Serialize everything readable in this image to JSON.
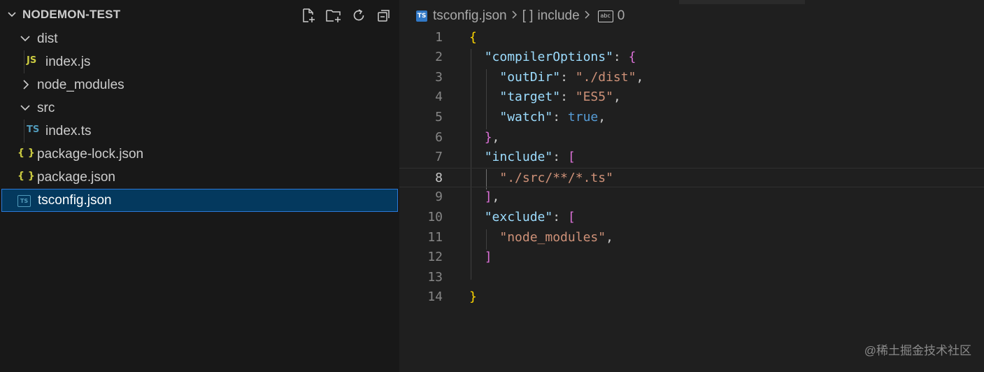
{
  "explorer": {
    "title": "NODEMON-TEST",
    "actions": [
      {
        "name": "new-file-icon"
      },
      {
        "name": "new-folder-icon"
      },
      {
        "name": "refresh-icon"
      },
      {
        "name": "collapse-all-icon"
      }
    ],
    "items": [
      {
        "label": "dist",
        "kind": "folder",
        "expanded": true,
        "depth": 0
      },
      {
        "label": "index.js",
        "kind": "file",
        "icon_text": "JS",
        "icon_color": "#cbcb41",
        "depth": 1
      },
      {
        "label": "node_modules",
        "kind": "folder",
        "expanded": false,
        "depth": 0
      },
      {
        "label": "src",
        "kind": "folder",
        "expanded": true,
        "depth": 0
      },
      {
        "label": "index.ts",
        "kind": "file",
        "icon_text": "TS",
        "icon_color": "#519aba",
        "depth": 1
      },
      {
        "label": "package-lock.json",
        "kind": "file",
        "icon_text": "{ }",
        "icon_color": "#cbcb41",
        "depth": 0
      },
      {
        "label": "package.json",
        "kind": "file",
        "icon_text": "{ }",
        "icon_color": "#cbcb41",
        "depth": 0
      },
      {
        "label": "tsconfig.json",
        "kind": "file",
        "icon_text": "TS",
        "icon_color": "#519aba",
        "depth": 0,
        "selected": true
      }
    ]
  },
  "breadcrumb": {
    "file": "tsconfig.json",
    "file_icon": "TS",
    "symbol": "include",
    "symbol_icon": "[ ]",
    "item_icon": "abc",
    "item": "0"
  },
  "editor": {
    "current_line": 8,
    "lines": [
      {
        "n": "1",
        "tokens": [
          [
            "p1",
            "{"
          ]
        ]
      },
      {
        "n": "2",
        "tokens": [
          [
            "pu",
            "  "
          ],
          [
            "k",
            "\"compilerOptions\""
          ],
          [
            "pu",
            ": "
          ],
          [
            "p2",
            "{"
          ]
        ]
      },
      {
        "n": "3",
        "tokens": [
          [
            "pu",
            "    "
          ],
          [
            "k",
            "\"outDir\""
          ],
          [
            "pu",
            ": "
          ],
          [
            "s",
            "\"./dist\""
          ],
          [
            "pu",
            ","
          ]
        ]
      },
      {
        "n": "4",
        "tokens": [
          [
            "pu",
            "    "
          ],
          [
            "k",
            "\"target\""
          ],
          [
            "pu",
            ": "
          ],
          [
            "s",
            "\"ES5\""
          ],
          [
            "pu",
            ","
          ]
        ]
      },
      {
        "n": "5",
        "tokens": [
          [
            "pu",
            "    "
          ],
          [
            "k",
            "\"watch\""
          ],
          [
            "pu",
            ": "
          ],
          [
            "b",
            "true"
          ],
          [
            "pu",
            ","
          ]
        ]
      },
      {
        "n": "6",
        "tokens": [
          [
            "pu",
            "  "
          ],
          [
            "p2",
            "}"
          ],
          [
            "pu",
            ","
          ]
        ]
      },
      {
        "n": "7",
        "tokens": [
          [
            "pu",
            "  "
          ],
          [
            "k",
            "\"include\""
          ],
          [
            "pu",
            ": "
          ],
          [
            "p2",
            "["
          ]
        ]
      },
      {
        "n": "8",
        "tokens": [
          [
            "pu",
            "    "
          ],
          [
            "s",
            "\"./src/**/*.ts\""
          ]
        ]
      },
      {
        "n": "9",
        "tokens": [
          [
            "pu",
            "  "
          ],
          [
            "p2",
            "]"
          ],
          [
            "pu",
            ","
          ]
        ]
      },
      {
        "n": "10",
        "tokens": [
          [
            "pu",
            "  "
          ],
          [
            "k",
            "\"exclude\""
          ],
          [
            "pu",
            ": "
          ],
          [
            "p2",
            "["
          ]
        ]
      },
      {
        "n": "11",
        "tokens": [
          [
            "pu",
            "    "
          ],
          [
            "s",
            "\"node_modules\""
          ],
          [
            "pu",
            ","
          ]
        ]
      },
      {
        "n": "12",
        "tokens": [
          [
            "pu",
            "  "
          ],
          [
            "p2",
            "]"
          ]
        ]
      },
      {
        "n": "13",
        "tokens": []
      },
      {
        "n": "14",
        "tokens": [
          [
            "p1",
            "}"
          ]
        ]
      }
    ]
  },
  "watermark": "@稀土掘金技术社区"
}
